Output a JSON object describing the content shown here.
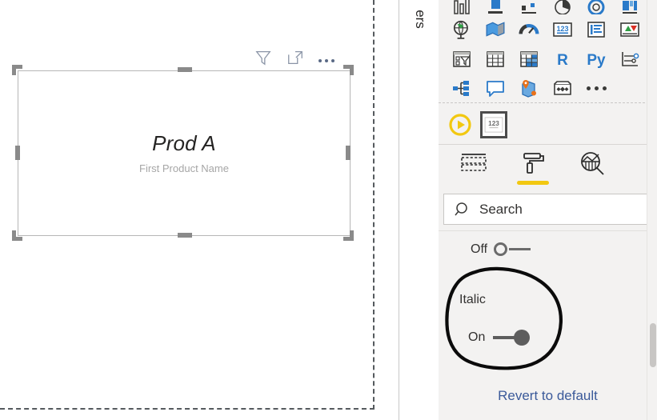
{
  "canvas": {
    "visual": {
      "value": "Prod A",
      "label": "First Product Name",
      "toolbar": {
        "filter_icon": "filter-icon",
        "focus_icon": "focus-mode-icon",
        "more_icon": "more-options-icon"
      }
    }
  },
  "filters_rail": {
    "label": "ers"
  },
  "visualizations": {
    "gallery_rows": [
      [
        {
          "name": "stacked-column-chart-icon"
        },
        {
          "name": "stacked-bar-chart-icon"
        },
        {
          "name": "line-and-stacked-column-chart-icon"
        },
        {
          "name": "pie-chart-icon"
        },
        {
          "name": "donut-chart-icon"
        },
        {
          "name": "treemap-icon"
        }
      ],
      [
        {
          "name": "map-icon"
        },
        {
          "name": "filled-map-icon"
        },
        {
          "name": "gauge-icon"
        },
        {
          "name": "card-icon"
        },
        {
          "name": "multi-row-card-icon"
        },
        {
          "name": "kpi-icon"
        }
      ],
      [
        {
          "name": "slicer-icon"
        },
        {
          "name": "table-icon"
        },
        {
          "name": "matrix-icon"
        },
        {
          "name": "r-script-visual-icon"
        },
        {
          "name": "python-visual-icon"
        },
        {
          "name": "key-influencers-icon"
        }
      ],
      [
        {
          "name": "decomposition-tree-icon"
        },
        {
          "name": "qna-icon"
        },
        {
          "name": "arcgis-map-icon"
        },
        {
          "name": "power-apps-icon"
        },
        {
          "name": "more-visuals-icon"
        }
      ]
    ],
    "selected_row": {
      "get_more_visuals_icon": "get-more-visuals-icon",
      "selected_visual_icon": "card-visual-selected-icon",
      "selected_visual_label": "123"
    },
    "tabs": [
      {
        "name": "fields-tab",
        "icon": "fields-icon",
        "active": false
      },
      {
        "name": "format-tab",
        "icon": "paint-roller-icon",
        "active": true
      },
      {
        "name": "analytics-tab",
        "icon": "analytics-magnifier-icon",
        "active": false
      }
    ],
    "search": {
      "placeholder": "Search",
      "value": "Search",
      "icon": "search-icon"
    },
    "settings": {
      "off_toggle_label": "Off",
      "italic_label": "Italic",
      "on_toggle_label": "On"
    },
    "revert_label": "Revert to default"
  },
  "annotation": {
    "shape": "hand-drawn-ellipse",
    "color": "#000000"
  },
  "colors": {
    "accent_yellow": "#f2c811",
    "panel_bg": "#f3f2f1",
    "link_blue": "#3b5a9a",
    "icon_blue": "#2a7ac9",
    "icon_dark": "#3a3a38",
    "handle_gray": "#8a8a8a"
  }
}
